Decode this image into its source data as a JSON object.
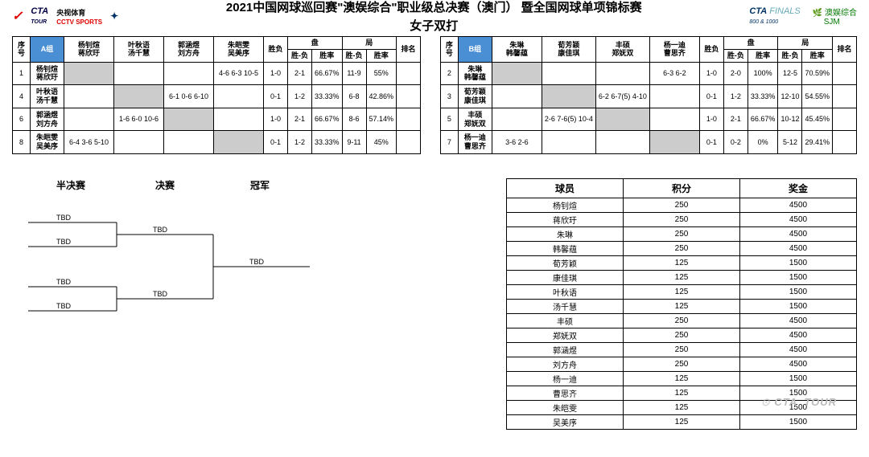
{
  "header": {
    "logo2_text": "CTA",
    "logo2_sub": "TOUR",
    "logo3_top": "央视体育",
    "logo3_bot": "CCTV SPORTS",
    "title_line1": "2021中国网球巡回赛\"澳娱综合\"职业级总决赛（澳门）  暨全国网球单项锦标赛",
    "title_line2": "女子双打",
    "finals_cta": "CTA",
    "finals_text": "FINALS",
    "finals_sub": "800 & 1000",
    "sjm_top": "澳娱综合",
    "sjm_bot": "SJM"
  },
  "groupA": {
    "label": "A组",
    "seq_h": "序号",
    "win_h": "胜负",
    "set_h": "盘",
    "game_h": "局",
    "rank_h": "排名",
    "sub_sf": "胜-负",
    "sub_sl": "胜率",
    "teams": [
      {
        "p1": "杨钊煊",
        "p2": "蒋欣玗"
      },
      {
        "p1": "叶秋语",
        "p2": "汤千慧"
      },
      {
        "p1": "郭涵煜",
        "p2": "刘方舟"
      },
      {
        "p1": "朱皑雯",
        "p2": "吴美序"
      }
    ],
    "rows": [
      {
        "seq": "1",
        "p1": "杨钊煊",
        "p2": "蒋欣玗",
        "c": [
          "",
          "",
          "",
          "4-6 6-3 10-5"
        ],
        "wl": "1-0",
        "s1": "2-1",
        "s2": "66.67%",
        "g1": "11-9",
        "g2": "55%",
        "rank": ""
      },
      {
        "seq": "4",
        "p1": "叶秋语",
        "p2": "汤千慧",
        "c": [
          "",
          "",
          "6-1 0-6 6-10",
          ""
        ],
        "wl": "0-1",
        "s1": "1-2",
        "s2": "33.33%",
        "g1": "6-8",
        "g2": "42.86%",
        "rank": ""
      },
      {
        "seq": "6",
        "p1": "郭涵煜",
        "p2": "刘方舟",
        "c": [
          "",
          "1-6 6-0 10-6",
          "",
          ""
        ],
        "wl": "1-0",
        "s1": "2-1",
        "s2": "66.67%",
        "g1": "8-6",
        "g2": "57.14%",
        "rank": ""
      },
      {
        "seq": "8",
        "p1": "朱皑雯",
        "p2": "吴美序",
        "c": [
          "6-4 3-6 5-10",
          "",
          "",
          ""
        ],
        "wl": "0-1",
        "s1": "1-2",
        "s2": "33.33%",
        "g1": "9-11",
        "g2": "45%",
        "rank": ""
      }
    ]
  },
  "groupB": {
    "label": "B组",
    "seq_h": "序号",
    "win_h": "胜负",
    "set_h": "盘",
    "game_h": "局",
    "rank_h": "排名",
    "sub_sf": "胜-负",
    "sub_sl": "胜率",
    "teams": [
      {
        "p1": "朱琳",
        "p2": "韩馨蕴"
      },
      {
        "p1": "荀芳颖",
        "p2": "康佳琪"
      },
      {
        "p1": "丰硕",
        "p2": "郑妩双"
      },
      {
        "p1": "杨一迪",
        "p2": "曹思齐"
      }
    ],
    "rows": [
      {
        "seq": "2",
        "p1": "朱琳",
        "p2": "韩馨蕴",
        "c": [
          "",
          "",
          "",
          "6-3 6-2"
        ],
        "wl": "1-0",
        "s1": "2-0",
        "s2": "100%",
        "g1": "12-5",
        "g2": "70.59%",
        "rank": ""
      },
      {
        "seq": "3",
        "p1": "荀芳颖",
        "p2": "康佳琪",
        "c": [
          "",
          "",
          "6-2 6-7(5) 4-10",
          ""
        ],
        "wl": "0-1",
        "s1": "1-2",
        "s2": "33.33%",
        "g1": "12-10",
        "g2": "54.55%",
        "rank": ""
      },
      {
        "seq": "5",
        "p1": "丰硕",
        "p2": "郑妩双",
        "c": [
          "",
          "2-6 7-6(5) 10-4",
          "",
          ""
        ],
        "wl": "1-0",
        "s1": "2-1",
        "s2": "66.67%",
        "g1": "10-12",
        "g2": "45.45%",
        "rank": ""
      },
      {
        "seq": "7",
        "p1": "杨一迪",
        "p2": "曹思齐",
        "c": [
          "3-6 2-6",
          "",
          "",
          ""
        ],
        "wl": "0-1",
        "s1": "0-2",
        "s2": "0%",
        "g1": "5-12",
        "g2": "29.41%",
        "rank": ""
      }
    ]
  },
  "bracket": {
    "semi": "半决赛",
    "final": "决赛",
    "champ": "冠军",
    "tbd": "TBD"
  },
  "points": {
    "h1": "球员",
    "h2": "积分",
    "h3": "奖金",
    "rows": [
      {
        "n": "杨钊煊",
        "p": "250",
        "m": "4500"
      },
      {
        "n": "蒋欣玗",
        "p": "250",
        "m": "4500"
      },
      {
        "n": "朱琳",
        "p": "250",
        "m": "4500"
      },
      {
        "n": "韩馨蕴",
        "p": "250",
        "m": "4500"
      },
      {
        "n": "荀芳颖",
        "p": "125",
        "m": "1500"
      },
      {
        "n": "康佳琪",
        "p": "125",
        "m": "1500"
      },
      {
        "n": "叶秋语",
        "p": "125",
        "m": "1500"
      },
      {
        "n": "汤千慧",
        "p": "125",
        "m": "1500"
      },
      {
        "n": "丰硕",
        "p": "250",
        "m": "4500"
      },
      {
        "n": "郑妩双",
        "p": "250",
        "m": "4500"
      },
      {
        "n": "郭涵煜",
        "p": "250",
        "m": "4500"
      },
      {
        "n": "刘方舟",
        "p": "250",
        "m": "4500"
      },
      {
        "n": "杨一迪",
        "p": "125",
        "m": "1500"
      },
      {
        "n": "曹思齐",
        "p": "125",
        "m": "1500"
      },
      {
        "n": "朱皑雯",
        "p": "125",
        "m": "1500"
      },
      {
        "n": "吴美序",
        "p": "125",
        "m": "1500"
      }
    ]
  },
  "watermark": "CTA_TOUR"
}
